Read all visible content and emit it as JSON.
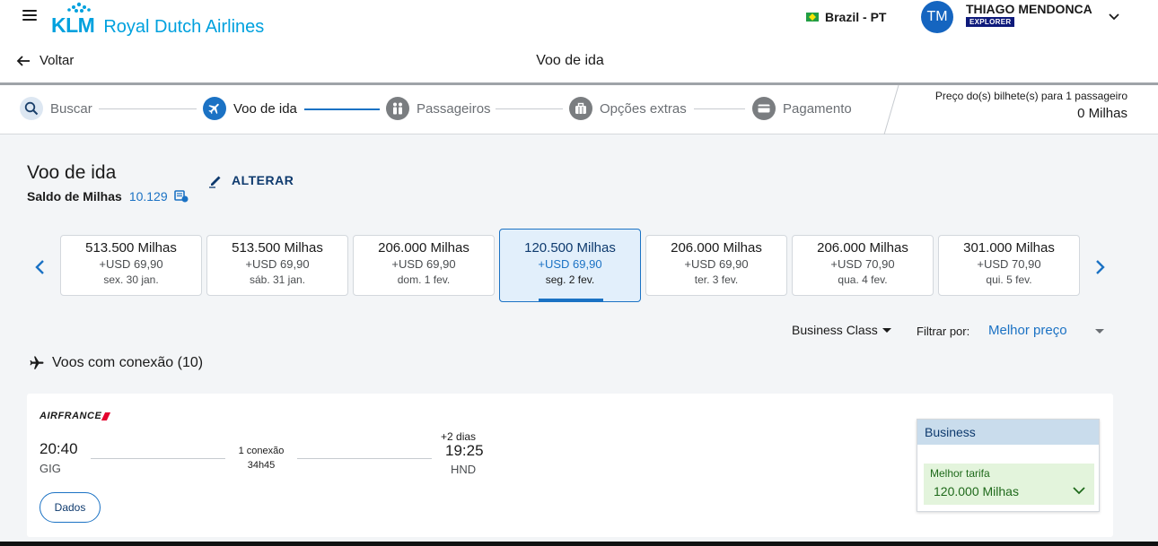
{
  "header": {
    "brand_short": "KLM",
    "brand_name": "Royal Dutch Airlines",
    "locale": "Brazil - PT",
    "user": {
      "initials": "TM",
      "name": "THIAGO MENDONCA",
      "tier": "EXPLORER"
    },
    "back_label": "Voltar",
    "page_title": "Voo de ida"
  },
  "stepper": {
    "steps": [
      {
        "label": "Buscar",
        "icon": "search-icon"
      },
      {
        "label": "Voo de ida",
        "icon": "plane-icon"
      },
      {
        "label": "Passageiros",
        "icon": "people-icon"
      },
      {
        "label": "Opções extras",
        "icon": "briefcase-icon"
      },
      {
        "label": "Pagamento",
        "icon": "credit-card-icon"
      }
    ],
    "active_index": 1,
    "price_label": "Preço do(s) bilhete(s) para 1 passageiro",
    "price_value": "0 Milhas"
  },
  "main": {
    "title": "Voo de ida",
    "balance_label": "Saldo de Milhas",
    "balance_value": "10.129",
    "change_label": "ALTERAR",
    "dates": [
      {
        "miles": "513.500 Milhas",
        "usd": "+USD 69,90",
        "day": "sex. 30 jan."
      },
      {
        "miles": "513.500 Milhas",
        "usd": "+USD 69,90",
        "day": "sáb. 31 jan."
      },
      {
        "miles": "206.000 Milhas",
        "usd": "+USD 69,90",
        "day": "dom. 1 fev."
      },
      {
        "miles": "120.500 Milhas",
        "usd": "+USD 69,90",
        "day": "seg. 2 fev."
      },
      {
        "miles": "206.000 Milhas",
        "usd": "+USD 69,90",
        "day": "ter. 3 fev."
      },
      {
        "miles": "206.000 Milhas",
        "usd": "+USD 70,90",
        "day": "qua. 4 fev."
      },
      {
        "miles": "301.000 Milhas",
        "usd": "+USD 70,90",
        "day": "qui. 5 fev."
      }
    ],
    "selected_date_index": 3,
    "cabin": "Business Class",
    "filter_label": "Filtrar por:",
    "filter_value": "Melhor preço",
    "connections_heading": "Voos com conexão (10)"
  },
  "flight": {
    "airline": "AIRFRANCE",
    "departure_time": "20:40",
    "departure_code": "GIG",
    "stops": "1 conexão",
    "duration": "34h45",
    "plus_days": "+2 dias",
    "arrival_time": "19:25",
    "arrival_code": "HND",
    "details_label": "Dados",
    "fare_class": "Business",
    "fare_best_label": "Melhor tarifa",
    "fare_miles": "120.000 Milhas"
  },
  "colors": {
    "brand_blue": "#00a1de",
    "accent_blue": "#1b72c4",
    "navy": "#0e3a6e",
    "fare_green": "#1f6a1b"
  }
}
